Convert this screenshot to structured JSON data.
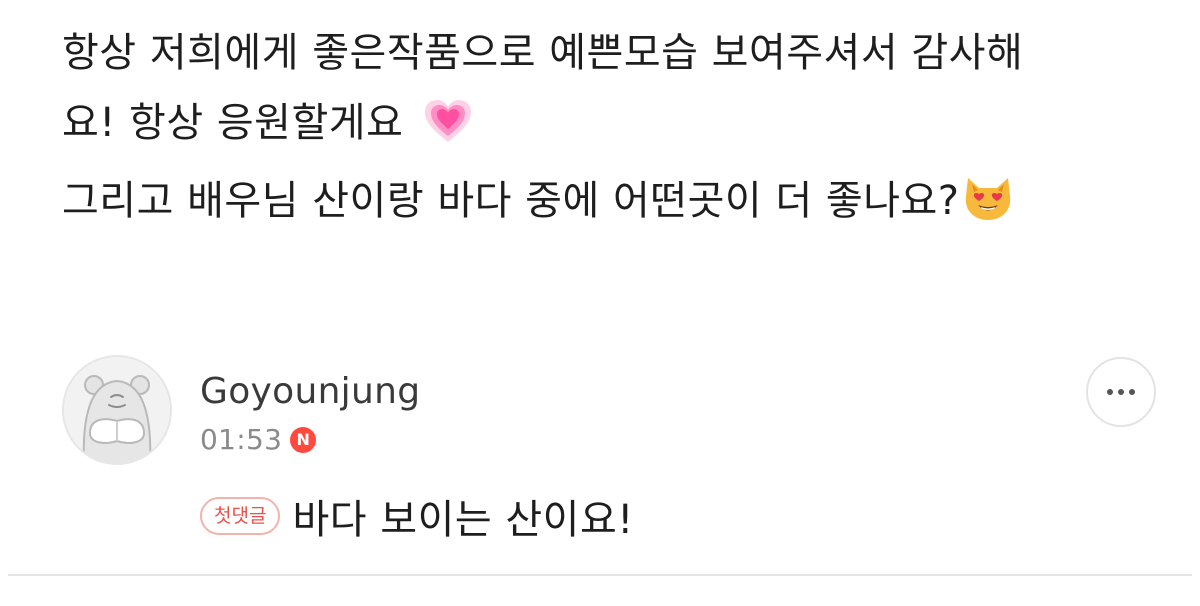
{
  "post": {
    "line1": "항상 저희에게 좋은작품으로 예쁜모습 보여주셔서 감사해",
    "line2": "요! 항상 응원할게요",
    "line3": "그리고 배우님 산이랑 바다 중에 어떤곳이 더 좋나요?",
    "emoji_line2": "growing-heart-icon",
    "emoji_line3": "heart-eyes-cat-icon"
  },
  "comment": {
    "author": "Goyounjung",
    "time": "01:53",
    "new_badge": "N",
    "first_comment_badge": "첫댓글",
    "text": "바다 보이는 산이요!",
    "avatar_icon": "hamster-avatar-icon",
    "more_icon": "more-dots-icon"
  },
  "colors": {
    "new_badge": "#ff4a3d",
    "first_badge_text": "#e8524a",
    "first_badge_border": "#f3b3ad",
    "heart": "#ff4fa0"
  }
}
